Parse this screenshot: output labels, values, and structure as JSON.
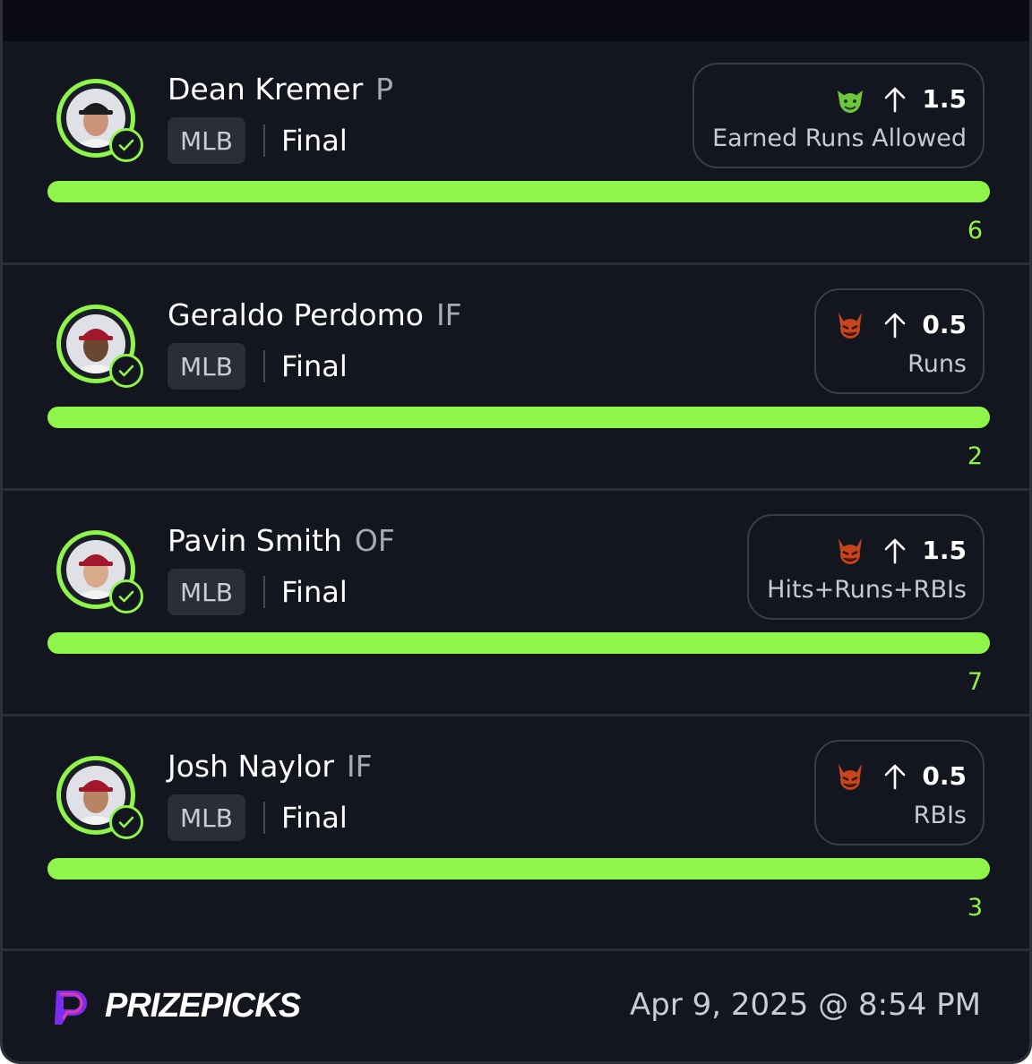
{
  "colors": {
    "accent_green": "#8ff54a",
    "background": "#14161f",
    "topbar": "#0a0b12"
  },
  "picks": [
    {
      "player": "Dean Kremer",
      "position": "P",
      "league": "MLB",
      "status": "Final",
      "pick_icon": "goblin-icon",
      "direction_icon": "arrow-up-icon",
      "line": "1.5",
      "stat": "Earned Runs Allowed",
      "progress_fraction": 1.0,
      "result": "6"
    },
    {
      "player": "Geraldo Perdomo",
      "position": "IF",
      "league": "MLB",
      "status": "Final",
      "pick_icon": "demon-icon",
      "direction_icon": "arrow-up-icon",
      "line": "0.5",
      "stat": "Runs",
      "progress_fraction": 1.0,
      "result": "2"
    },
    {
      "player": "Pavin Smith",
      "position": "OF",
      "league": "MLB",
      "status": "Final",
      "pick_icon": "demon-icon",
      "direction_icon": "arrow-up-icon",
      "line": "1.5",
      "stat": "Hits+Runs+RBIs",
      "progress_fraction": 1.0,
      "result": "7"
    },
    {
      "player": "Josh Naylor",
      "position": "IF",
      "league": "MLB",
      "status": "Final",
      "pick_icon": "demon-icon",
      "direction_icon": "arrow-up-icon",
      "line": "0.5",
      "stat": "RBIs",
      "progress_fraction": 1.0,
      "result": "3"
    }
  ],
  "footer": {
    "brand": "PRIZEPICKS",
    "timestamp": "Apr 9, 2025 @ 8:54 PM"
  }
}
